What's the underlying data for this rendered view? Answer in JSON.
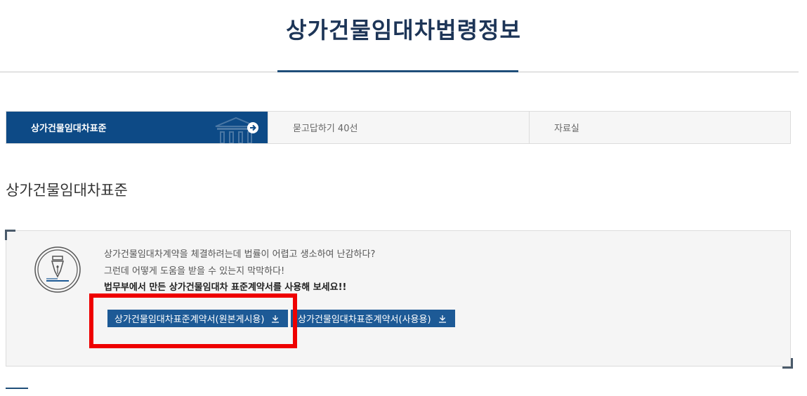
{
  "header": {
    "title": "상가건물임대차법령정보"
  },
  "tabs": [
    {
      "label": "상가건물임대차표준"
    },
    {
      "label": "묻고답하기 40선"
    },
    {
      "label": "자료실"
    }
  ],
  "section": {
    "title": "상가건물임대차표준"
  },
  "info": {
    "line1": "상가건물임대차계약을 체결하려는데 법률이 어렵고 생소하여 난감하다?",
    "line2": "그런데 어떻게 도움을 받을 수 있는지 막막하다!",
    "line3": "법무부에서 만든 상가건물임대차 표준계약서를 사용해 보세요!!"
  },
  "downloads": [
    {
      "label": "상가건물임대차표준계약서(원본게시용)"
    },
    {
      "label": "상가건물임대차표준계약서(사용용)"
    }
  ],
  "colors": {
    "accent": "#0d4a86",
    "button": "#1d5a96",
    "highlight": "#ee0000"
  },
  "icons": {
    "tab_arrow": "arrow-right-circle-icon",
    "tab_bg": "building-icon",
    "info": "fountain-pen-icon",
    "download": "download-icon"
  }
}
